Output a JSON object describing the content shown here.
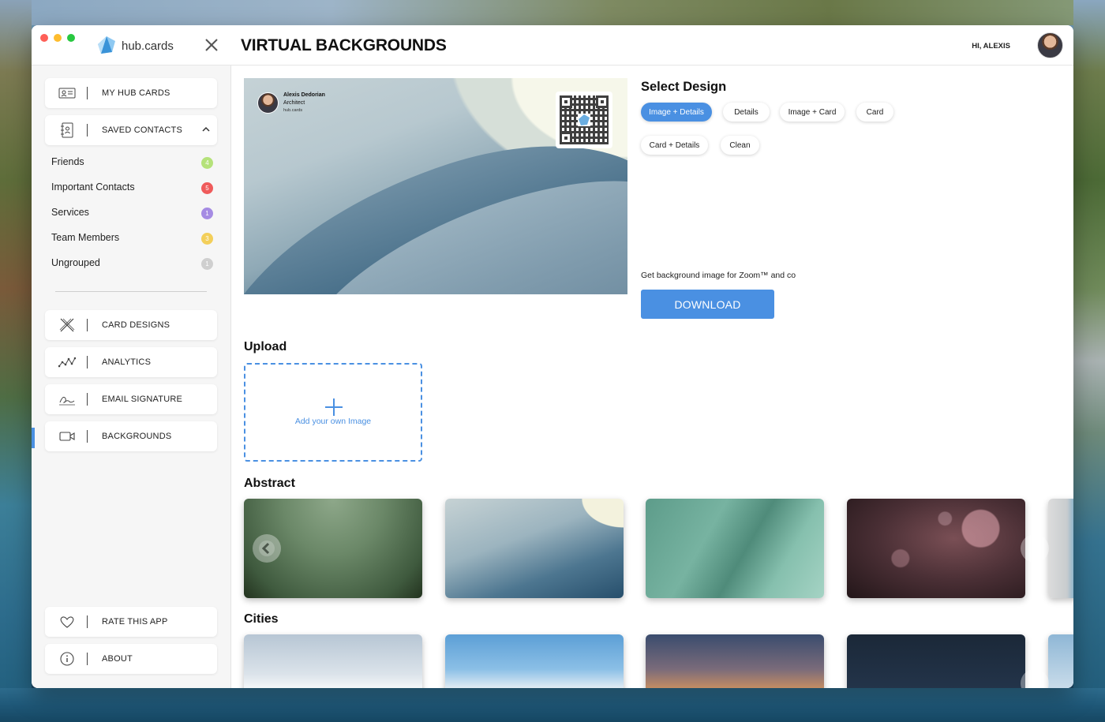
{
  "app": {
    "brand": "hub.cards",
    "page_title": "VIRTUAL BACKGROUNDS",
    "greeting": "HI, ALEXIS",
    "accent": "#4a90e2"
  },
  "sidebar": {
    "top_items": [
      {
        "label": "MY HUB CARDS",
        "icon": "id-card-icon"
      },
      {
        "label": "SAVED CONTACTS",
        "icon": "address-book-icon"
      }
    ],
    "groups": [
      {
        "label": "Friends",
        "count": "4",
        "color": "#b5e27a"
      },
      {
        "label": "Important Contacts",
        "count": "5",
        "color": "#ef5b5b"
      },
      {
        "label": "Services",
        "count": "1",
        "color": "#a58be3"
      },
      {
        "label": "Team Members",
        "count": "3",
        "color": "#f3cf5a"
      },
      {
        "label": "Ungrouped",
        "count": "1",
        "color": "#cfcfcf"
      }
    ],
    "tools": [
      {
        "label": "CARD DESIGNS",
        "icon": "pencil-ruler-icon"
      },
      {
        "label": "ANALYTICS",
        "icon": "analytics-icon"
      },
      {
        "label": "EMAIL SIGNATURE",
        "icon": "signature-icon"
      },
      {
        "label": "BACKGROUNDS",
        "icon": "video-camera-icon"
      }
    ],
    "bottom": [
      {
        "label": "RATE THIS APP",
        "icon": "heart-icon"
      },
      {
        "label": "ABOUT",
        "icon": "info-icon"
      }
    ]
  },
  "preview": {
    "name": "Alexis Dedorian",
    "role": "Architect",
    "site": "hub.cards"
  },
  "design": {
    "title": "Select Design",
    "options": [
      "Image + Details",
      "Details",
      "Image + Card",
      "Card",
      "Card + Details",
      "Clean"
    ],
    "selected": "Image + Details",
    "zoom_text": "Get background image for Zoom™ and co",
    "download_label": "DOWNLOAD"
  },
  "upload": {
    "title": "Upload",
    "label": "Add your own Image"
  },
  "sections": {
    "abstract_title": "Abstract",
    "cities_title": "Cities"
  }
}
